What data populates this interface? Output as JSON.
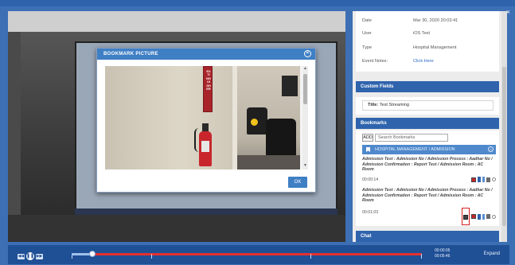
{
  "window": {
    "close_glyph": "×"
  },
  "modal": {
    "title": "BOOKMARK PICTURE",
    "close_glyph": "×",
    "ok_label": "OK",
    "sign_text": "EXTINGUISHER"
  },
  "info": {
    "rows": [
      {
        "key": "Date",
        "value": "Mar 30, 2020 20:03:41"
      },
      {
        "key": "User",
        "value": "iOS Test"
      },
      {
        "key": "Type",
        "value": "Hospital Management"
      },
      {
        "key": "Event Notes:",
        "value": "Click Here"
      }
    ]
  },
  "custom_fields": {
    "heading": "Custom Fields",
    "title_key": "Title:",
    "title_value": "Test Streaming"
  },
  "bookmarks": {
    "heading": "Bookmarks",
    "add_label": "ADD",
    "search_placeholder": "Search Bookmarks",
    "group_label": "HOSPITAL MANAGEMENT / ADMISSION",
    "items": [
      {
        "desc": "Admission Test : Admission No / Admission Process : Aadhar No / Admission Confirmation : Report Test / Admission Room : AC Room",
        "time": "00:00:14"
      },
      {
        "desc": "Admission Test : Admission No / Admission Process : Aadhar No / Admission Confirmation : Report Test / Admission Room : AC Room",
        "time": "00:01:03"
      }
    ]
  },
  "chat": {
    "heading": "Chat"
  },
  "player": {
    "position_time": "00:00:05",
    "duration_time": "00:05:46",
    "expand_label": "Expand",
    "progress_fraction": 0.06
  }
}
